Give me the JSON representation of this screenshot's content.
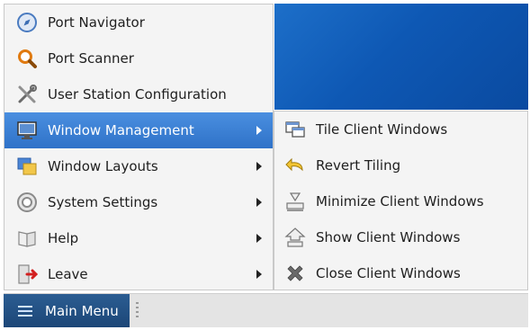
{
  "main_menu": {
    "items": [
      {
        "label": "Port Navigator",
        "icon": "compass-icon",
        "has_submenu": false
      },
      {
        "label": "Port Scanner",
        "icon": "magnifier-icon",
        "has_submenu": false
      },
      {
        "label": "User Station Configuration",
        "icon": "tools-icon",
        "has_submenu": false
      },
      {
        "label": "Window Management",
        "icon": "monitor-icon",
        "has_submenu": true,
        "active": true
      },
      {
        "label": "Window Layouts",
        "icon": "layouts-icon",
        "has_submenu": true
      },
      {
        "label": "System Settings",
        "icon": "settings-icon",
        "has_submenu": true
      },
      {
        "label": "Help",
        "icon": "help-book-icon",
        "has_submenu": true
      },
      {
        "label": "Leave",
        "icon": "leave-door-icon",
        "has_submenu": true
      }
    ]
  },
  "submenu": {
    "items": [
      {
        "label": "Tile Client Windows",
        "icon": "tile-windows-icon"
      },
      {
        "label": "Revert Tiling",
        "icon": "revert-arrow-icon"
      },
      {
        "label": "Minimize Client Windows",
        "icon": "minimize-icon"
      },
      {
        "label": "Show Client Windows",
        "icon": "show-windows-icon"
      },
      {
        "label": "Close Client Windows",
        "icon": "close-x-icon"
      }
    ]
  },
  "taskbar": {
    "start_label": "Main Menu",
    "start_icon": "hamburger-icon"
  },
  "colors": {
    "accent": "#2f72c8",
    "desktop": "#0e58b4",
    "taskbar_button": "#1c4677"
  }
}
